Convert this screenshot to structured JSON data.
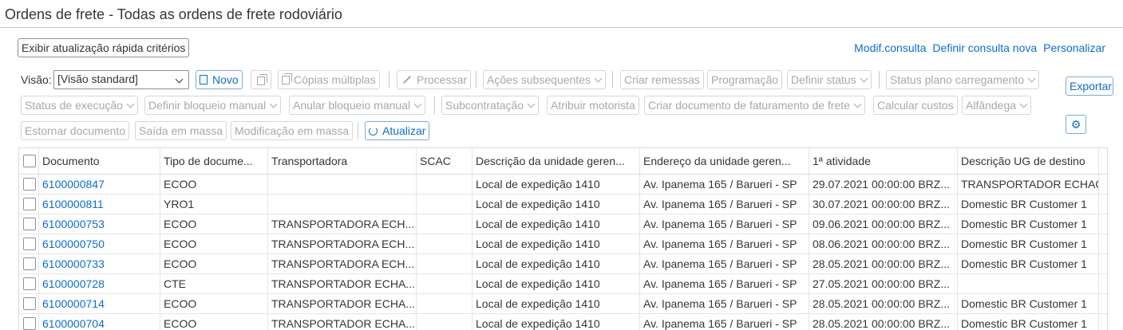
{
  "page": {
    "title": "Ordens de frete - Todas as ordens de frete rodoviário"
  },
  "top_bar": {
    "quick_criteria_button": "Exibir atualização rápida critérios",
    "links": [
      "Modif.consulta",
      "Definir consulta nova",
      "Personalizar"
    ]
  },
  "toolbar": {
    "view_label": "Visão:",
    "view_value": "[Visão standard]",
    "new": "Novo",
    "multiple_copies": "Cópias múltiplas",
    "process": "Processar",
    "subsequent_actions": "Ações subsequentes",
    "create_deliveries": "Criar remessas",
    "scheduling": "Programação",
    "define_status": "Definir status",
    "load_plan_status": "Status plano carregamento",
    "export": "Exportar",
    "execution_status": "Status de execução",
    "define_manual_block": "Definir bloqueio manual",
    "cancel_manual_block": "Anular bloqueio manual",
    "subcontracting": "Subcontratação",
    "assign_driver": "Atribuir motorista",
    "create_freight_billing": "Criar documento de faturamento de frete",
    "calculate_costs": "Calcular custos",
    "customs": "Alfândega",
    "reverse_document": "Estornar documento",
    "mass_exit": "Saída em massa",
    "mass_modification": "Modificação em massa",
    "refresh": "Atualizar"
  },
  "table": {
    "columns": [
      "Documento",
      "Tipo de docume...",
      "Transportadora",
      "SCAC",
      "Descrição da unidade geren...",
      "Endereço da unidade geren...",
      "1ª atividade",
      "Descrição UG de destino"
    ],
    "rows": [
      [
        "6100000847",
        "ECOO",
        "",
        "",
        "Local de expedição 1410",
        "Av. Ipanema 165 / Barueri - SP",
        "29.07.2021 00:00:00 BRZ...",
        "TRANSPORTADOR ECHAGAS"
      ],
      [
        "6100000811",
        "YRO1",
        "",
        "",
        "Local de expedição 1410",
        "Av. Ipanema 165 / Barueri - SP",
        "30.07.2021 00:00:00 BRZ...",
        "Domestic BR Customer 1"
      ],
      [
        "6100000753",
        "ECOO",
        "TRANSPORTADORA ECH...",
        "",
        "Local de expedição 1410",
        "Av. Ipanema 165 / Barueri - SP",
        "09.06.2021 00:00:00 BRZ...",
        "Domestic BR Customer 1"
      ],
      [
        "6100000750",
        "ECOO",
        "TRANSPORTADORA ECH...",
        "",
        "Local de expedição 1410",
        "Av. Ipanema 165 / Barueri - SP",
        "08.06.2021 00:00:00 BRZ...",
        "Domestic BR Customer 1"
      ],
      [
        "6100000733",
        "ECOO",
        "TRANSPORTADORA ECH...",
        "",
        "Local de expedição 1410",
        "Av. Ipanema 165 / Barueri - SP",
        "28.05.2021 00:00:00 BRZ...",
        "Domestic BR Customer 1"
      ],
      [
        "6100000728",
        "CTE",
        "TRANSPORTADOR ECHA...",
        "",
        "Local de expedição 1410",
        "Av. Ipanema 165 / Barueri - SP",
        "27.05.2021 00:00:00 BRZ...",
        ""
      ],
      [
        "6100000714",
        "ECOO",
        "TRANSPORTADOR ECHA...",
        "",
        "Local de expedição 1410",
        "Av. Ipanema 165 / Barueri - SP",
        "28.05.2021 00:00:00 BRZ...",
        "Domestic BR Customer 1"
      ],
      [
        "6100000704",
        "ECOO",
        "TRANSPORTADOR ECHA...",
        "",
        "Local de expedição 1410",
        "Av. Ipanema 165 / Barueri - SP",
        "28.05.2021 00:00:00 BRZ...",
        "Domestic BR Customer 1"
      ]
    ]
  }
}
